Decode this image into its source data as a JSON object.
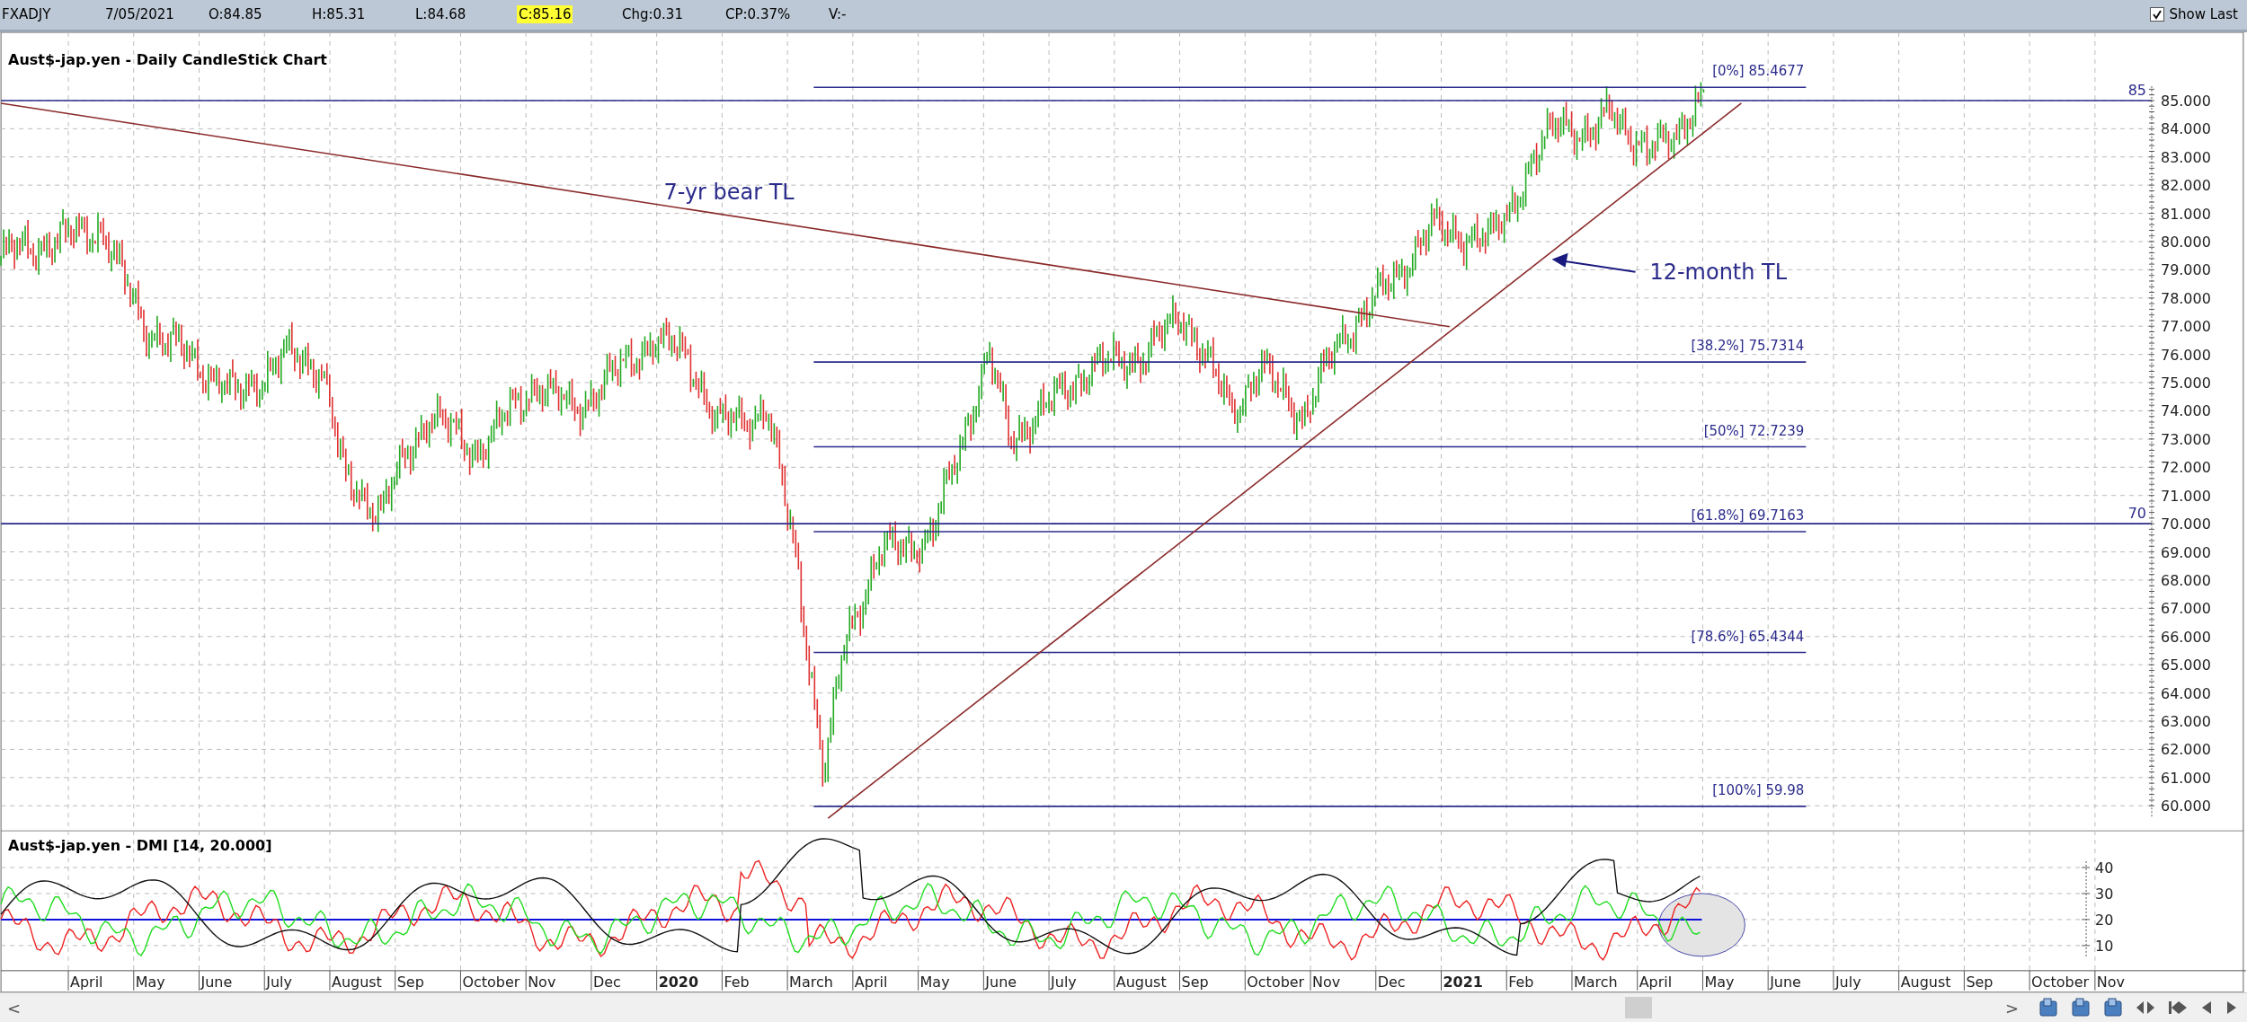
{
  "toolbar": {
    "fields": [
      {
        "text": "FXADJY",
        "highlight": false
      },
      {
        "text": "7/05/2021",
        "highlight": false
      },
      {
        "text": "O:84.85",
        "highlight": false
      },
      {
        "text": "H:85.31",
        "highlight": false
      },
      {
        "text": "L:84.68",
        "highlight": false
      },
      {
        "text": "C:85.16",
        "highlight": true
      },
      {
        "text": "Chg:0.31",
        "highlight": false
      },
      {
        "text": "CP:0.37%",
        "highlight": false
      },
      {
        "text": "V:-",
        "highlight": false
      }
    ],
    "show_last": {
      "label": "Show Last",
      "checked": true
    }
  },
  "price_panel": {
    "title": "Aust$-jap.yen - Daily CandleStick Chart",
    "axis_labels": [
      "85.000",
      "84.000",
      "83.000",
      "82.000",
      "81.000",
      "80.000",
      "79.000",
      "78.000",
      "77.000",
      "76.000",
      "75.000",
      "74.000",
      "73.000",
      "72.000",
      "71.000",
      "70.000",
      "69.000",
      "68.000",
      "67.000",
      "66.000",
      "65.000",
      "64.000",
      "63.000",
      "62.000",
      "61.000",
      "60.000"
    ],
    "level_lines": [
      {
        "label": "85"
      },
      {
        "label": "70"
      }
    ],
    "fibonacci": [
      {
        "label": "[0%] 85.4677"
      },
      {
        "label": "[38.2%] 75.7314"
      },
      {
        "label": "[50%] 72.7239"
      },
      {
        "label": "[61.8%] 69.7163"
      },
      {
        "label": "[78.6%] 65.4344"
      },
      {
        "label": "[100%] 59.98"
      }
    ],
    "annotations": [
      {
        "kind": "bear",
        "text": "7-yr bear TL"
      },
      {
        "kind": "rising",
        "text": "12-month TL"
      }
    ]
  },
  "dmi_panel": {
    "title": "Aust$-jap.yen - DMI [14, 20.000]",
    "axis_labels": [
      "40",
      "30",
      "20",
      "10"
    ]
  },
  "time_axis": [
    {
      "text": "April",
      "kind": "month"
    },
    {
      "text": "May",
      "kind": "month"
    },
    {
      "text": "June",
      "kind": "month"
    },
    {
      "text": "July",
      "kind": "month"
    },
    {
      "text": "August",
      "kind": "month"
    },
    {
      "text": "Sep",
      "kind": "month"
    },
    {
      "text": "October",
      "kind": "month"
    },
    {
      "text": "Nov",
      "kind": "month"
    },
    {
      "text": "Dec",
      "kind": "month"
    },
    {
      "text": "2020",
      "kind": "year"
    },
    {
      "text": "Feb",
      "kind": "month"
    },
    {
      "text": "March",
      "kind": "month"
    },
    {
      "text": "April",
      "kind": "month"
    },
    {
      "text": "May",
      "kind": "month"
    },
    {
      "text": "June",
      "kind": "month"
    },
    {
      "text": "July",
      "kind": "month"
    },
    {
      "text": "August",
      "kind": "month"
    },
    {
      "text": "Sep",
      "kind": "month"
    },
    {
      "text": "October",
      "kind": "month"
    },
    {
      "text": "Nov",
      "kind": "month"
    },
    {
      "text": "Dec",
      "kind": "month"
    },
    {
      "text": "2021",
      "kind": "year"
    },
    {
      "text": "Feb",
      "kind": "month"
    },
    {
      "text": "March",
      "kind": "month"
    },
    {
      "text": "April",
      "kind": "month"
    },
    {
      "text": "May",
      "kind": "month"
    },
    {
      "text": "June",
      "kind": "month"
    },
    {
      "text": "July",
      "kind": "month"
    },
    {
      "text": "August",
      "kind": "month"
    },
    {
      "text": "Sep",
      "kind": "month"
    },
    {
      "text": "October",
      "kind": "month"
    },
    {
      "text": "Nov",
      "kind": "month"
    }
  ],
  "scrollbar": {
    "left": "<",
    "right": ">"
  }
}
